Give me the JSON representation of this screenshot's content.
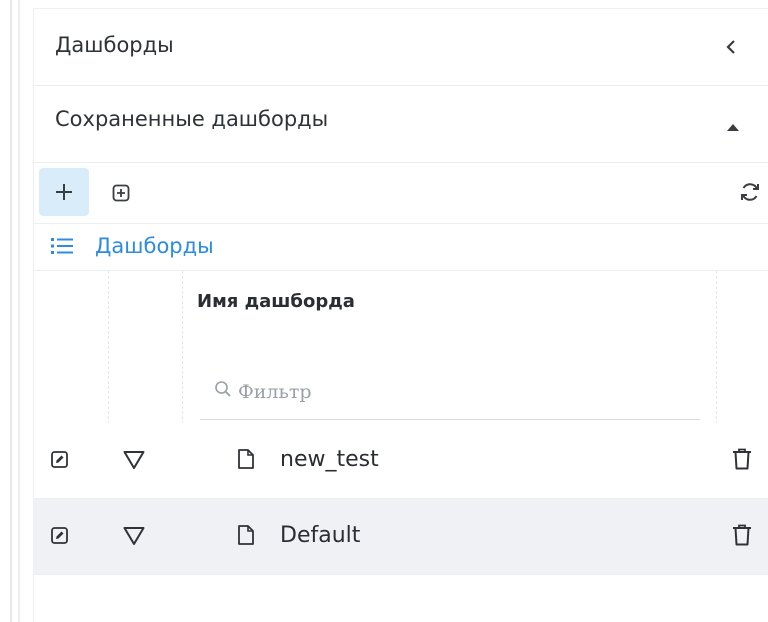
{
  "panel": {
    "title": "Дашборды",
    "collapse_icon": "chevron-left-icon"
  },
  "saved": {
    "title": "Сохраненные дашборды",
    "toggle_icon": "caret-up-icon"
  },
  "toolbar": {
    "add_icon": "plus-icon",
    "import_icon": "plus-square-icon",
    "refresh_icon": "refresh-icon"
  },
  "list": {
    "title": "Дашборды",
    "title_icon": "list-icon",
    "accent": "#2d8be0"
  },
  "table": {
    "column_name_header": "Имя дашборда",
    "filter_placeholder": "Фильтр",
    "rows": [
      {
        "name": "new_test"
      },
      {
        "name": "Default"
      }
    ]
  },
  "colors": {
    "add_button_bg": "#d9ecfa",
    "selected_row_bg": "#eff1f4"
  }
}
